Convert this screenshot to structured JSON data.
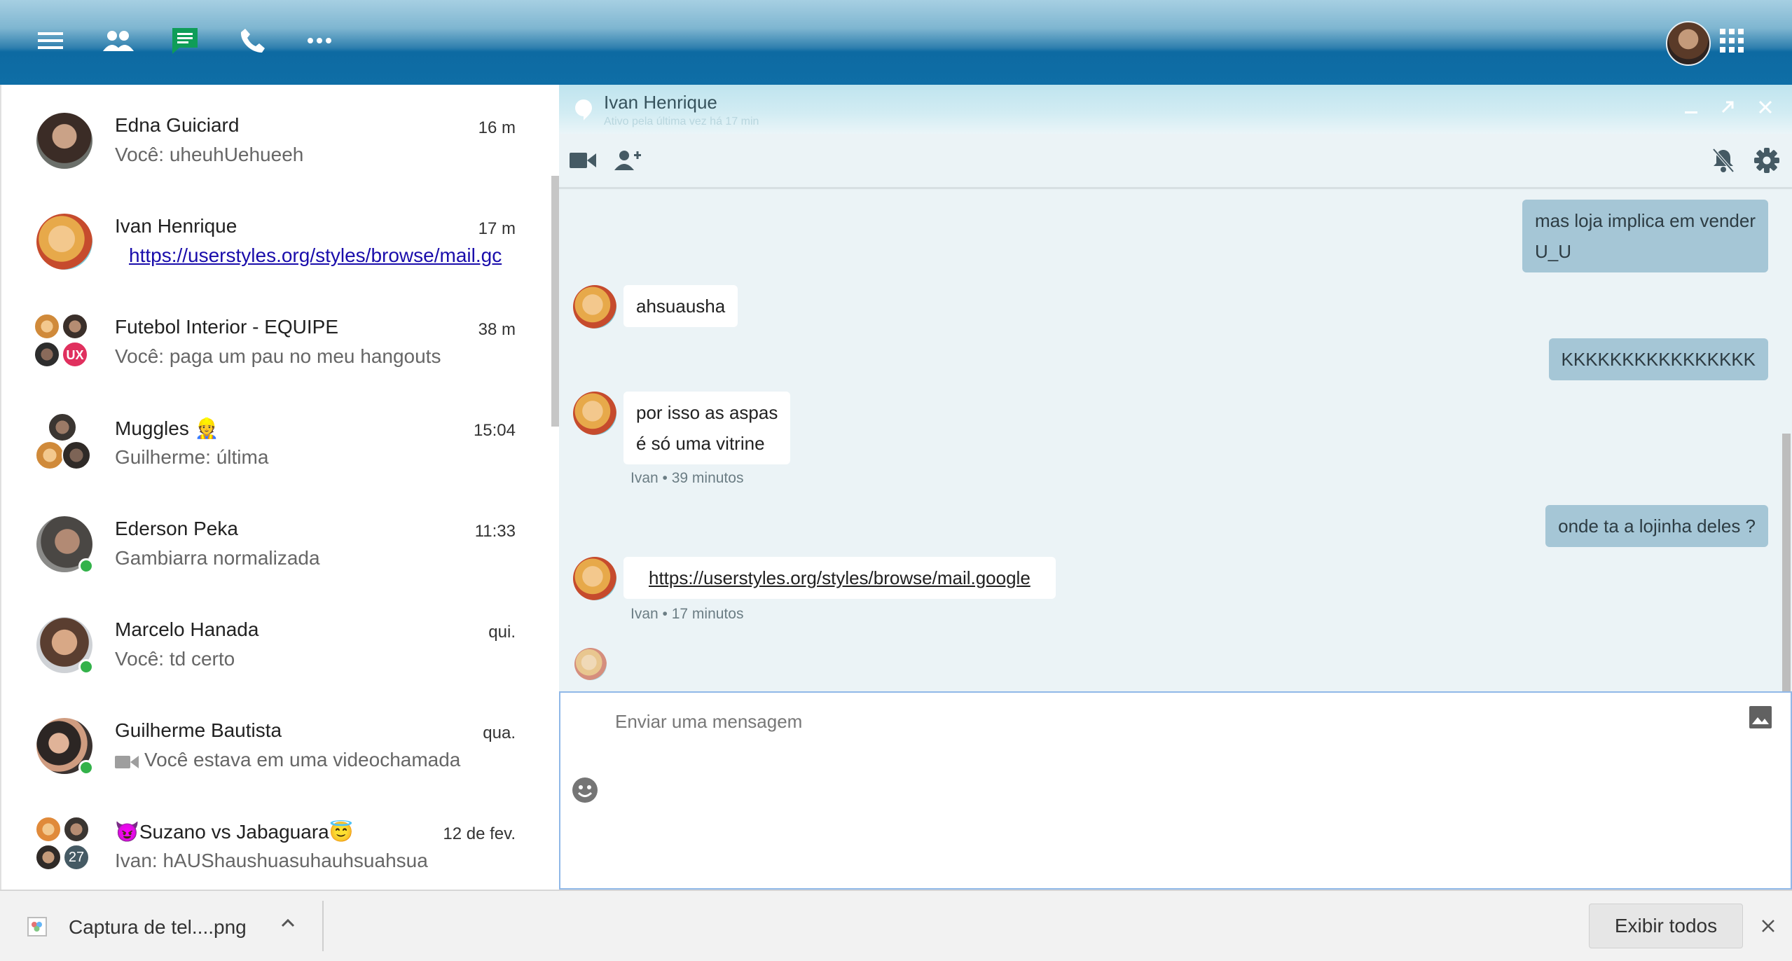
{
  "topbar": {
    "icons": [
      "menu-icon",
      "contacts-icon",
      "chat-icon",
      "phone-icon",
      "more-icon",
      "apps-grid-icon"
    ],
    "accent": "#0f6ea6",
    "chat_icon_color": "#0f9d58"
  },
  "conversations": [
    {
      "name": "Edna Guiciard",
      "time": "16 m",
      "snippet": "Você: uheuhUehueeh"
    },
    {
      "name": "Ivan Henrique",
      "time": "17 m",
      "snippet": "https://userstyles.org/styles/browse/mail.gc"
    },
    {
      "name": "Futebol Interior - EQUIPE",
      "time": "38 m",
      "snippet": "Você: paga um pau no meu hangouts"
    },
    {
      "name": "Muggles 👷",
      "time": "15:04",
      "snippet": "Guilherme: última"
    },
    {
      "name": "Ederson Peka",
      "time": "11:33",
      "snippet": "Gambiarra normalizada"
    },
    {
      "name": "Marcelo Hanada",
      "time": "qui.",
      "snippet": "Você: td certo"
    },
    {
      "name": "Guilherme Bautista",
      "time": "qua.",
      "snippet": "Você estava em uma videochamada"
    },
    {
      "name": "😈Suzano vs Jabaguara😇",
      "time": "12 de fev.",
      "snippet": "Ivan: hAUShaushuasuhauhsuahsua",
      "badge": "27"
    }
  ],
  "chat": {
    "title": "Ivan Henrique",
    "status": "Ativo pela última vez há 17 min",
    "messages": [
      {
        "dir": "out",
        "lines": [
          "mas loja implica em vender",
          "U_U"
        ]
      },
      {
        "dir": "in",
        "lines": [
          "ahsuausha"
        ]
      },
      {
        "dir": "out",
        "lines": [
          "KKKKKKKKKKKKKKKK"
        ]
      },
      {
        "dir": "in",
        "lines": [
          "por isso as aspas",
          "é só uma vitrine"
        ],
        "meta": "Ivan • 39 minutos"
      },
      {
        "dir": "out",
        "lines": [
          "onde ta a lojinha deles ?"
        ]
      },
      {
        "dir": "in",
        "link": "https://userstyles.org/styles/browse/mail.google",
        "meta": "Ivan • 17 minutos"
      }
    ],
    "compose_placeholder": "Enviar uma mensagem"
  },
  "downloads": {
    "file_name": "Captura de tel....png",
    "show_all": "Exibir todos"
  }
}
